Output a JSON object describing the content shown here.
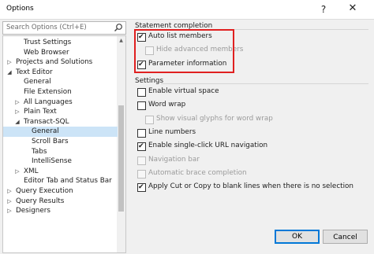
{
  "window": {
    "title": "Options",
    "help_glyph": "?",
    "close_glyph": "✕"
  },
  "search": {
    "placeholder": "Search Options (Ctrl+E)"
  },
  "tree": {
    "items": [
      {
        "label": "Trust Settings",
        "level": 1,
        "arrow": "",
        "selected": false
      },
      {
        "label": "Web Browser",
        "level": 1,
        "arrow": "",
        "selected": false
      },
      {
        "label": "Projects and Solutions",
        "level": 0,
        "arrow": "▷",
        "selected": false
      },
      {
        "label": "Text Editor",
        "level": 0,
        "arrow": "◢",
        "selected": false
      },
      {
        "label": "General",
        "level": 1,
        "arrow": "",
        "selected": false
      },
      {
        "label": "File Extension",
        "level": 1,
        "arrow": "",
        "selected": false
      },
      {
        "label": "All Languages",
        "level": 1,
        "arrow": "▷",
        "selected": false
      },
      {
        "label": "Plain Text",
        "level": 1,
        "arrow": "▷",
        "selected": false
      },
      {
        "label": "Transact-SQL",
        "level": 1,
        "arrow": "◢",
        "selected": false
      },
      {
        "label": "General",
        "level": 2,
        "arrow": "",
        "selected": true
      },
      {
        "label": "Scroll Bars",
        "level": 2,
        "arrow": "",
        "selected": false
      },
      {
        "label": "Tabs",
        "level": 2,
        "arrow": "",
        "selected": false
      },
      {
        "label": "IntelliSense",
        "level": 2,
        "arrow": "",
        "selected": false
      },
      {
        "label": "XML",
        "level": 1,
        "arrow": "▷",
        "selected": false
      },
      {
        "label": "Editor Tab and Status Bar",
        "level": 1,
        "arrow": "",
        "selected": false
      },
      {
        "label": "Query Execution",
        "level": 0,
        "arrow": "▷",
        "selected": false
      },
      {
        "label": "Query Results",
        "level": 0,
        "arrow": "▷",
        "selected": false
      },
      {
        "label": "Designers",
        "level": 0,
        "arrow": "▷",
        "selected": false
      }
    ]
  },
  "statement_completion": {
    "title": "Statement completion",
    "options": [
      {
        "label": "Auto list members",
        "checked": true,
        "disabled": false,
        "indent": 0
      },
      {
        "label": "Hide advanced members",
        "checked": false,
        "disabled": true,
        "indent": 1
      },
      {
        "label": "Parameter information",
        "checked": true,
        "disabled": false,
        "indent": 0
      }
    ]
  },
  "settings": {
    "title": "Settings",
    "options": [
      {
        "label": "Enable virtual space",
        "checked": false,
        "disabled": false,
        "indent": 0
      },
      {
        "label": "Word wrap",
        "checked": false,
        "disabled": false,
        "indent": 0
      },
      {
        "label": "Show visual glyphs for word wrap",
        "checked": false,
        "disabled": true,
        "indent": 1
      },
      {
        "label": "Line numbers",
        "checked": false,
        "disabled": false,
        "indent": 0
      },
      {
        "label": "Enable single-click URL navigation",
        "checked": true,
        "disabled": false,
        "indent": 0
      },
      {
        "label": "Navigation bar",
        "checked": false,
        "disabled": true,
        "indent": 0
      },
      {
        "label": "Automatic brace completion",
        "checked": false,
        "disabled": true,
        "indent": 0
      },
      {
        "label": "Apply Cut or Copy to blank lines when there is no selection",
        "checked": true,
        "disabled": false,
        "indent": 0
      }
    ]
  },
  "buttons": {
    "ok": "OK",
    "cancel": "Cancel"
  },
  "colors": {
    "selection": "#cce4f7",
    "highlight_box": "#e02020",
    "ok_border": "#0078d7"
  }
}
